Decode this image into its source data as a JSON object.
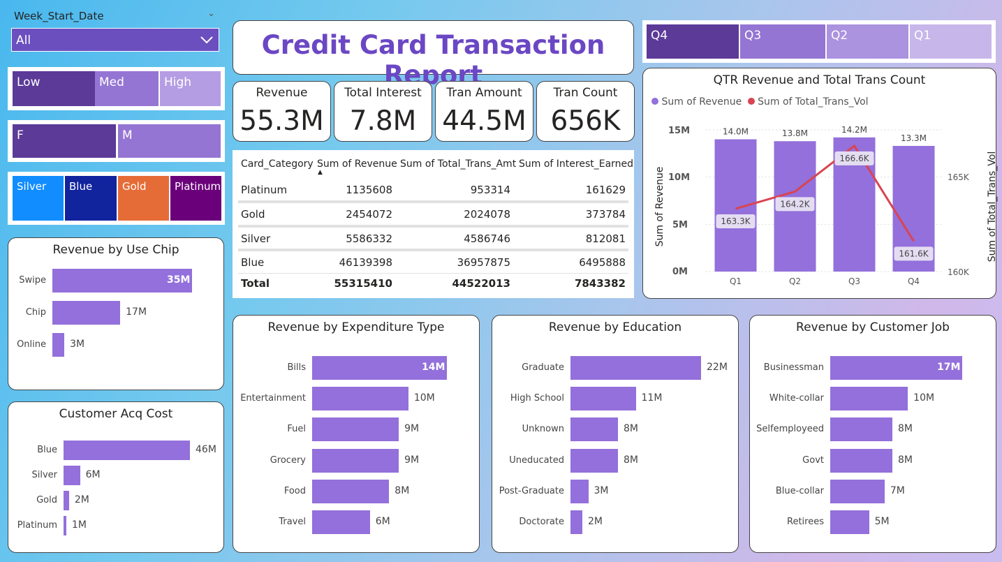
{
  "week_slicer": {
    "label": "Week_Start_Date",
    "selected": "All"
  },
  "income_slicer": {
    "items": [
      "Low",
      "Med",
      "High"
    ]
  },
  "gender_slicer": {
    "items": [
      "F",
      "M"
    ]
  },
  "card_slicer": {
    "items": [
      "Silver",
      "Blue",
      "Gold",
      "Platinum"
    ]
  },
  "quarter_slicer": {
    "items": [
      "Q4",
      "Q3",
      "Q2",
      "Q1"
    ]
  },
  "report_title": "Credit Card Transaction Report",
  "kpis": [
    {
      "label": "Revenue",
      "value": "55.3M"
    },
    {
      "label": "Total Interest",
      "value": "7.8M"
    },
    {
      "label": "Tran Amount",
      "value": "44.5M"
    },
    {
      "label": "Tran Count",
      "value": "656K"
    }
  ],
  "matrix": {
    "headers": [
      "Card_Category",
      "Sum of Revenue",
      "Sum of Total_Trans_Amt",
      "Sum of Interest_Earned"
    ],
    "rows": [
      [
        "Platinum",
        "1135608",
        "953314",
        "161629"
      ],
      [
        "Gold",
        "2454072",
        "2024078",
        "373784"
      ],
      [
        "Silver",
        "5586332",
        "4586746",
        "812081"
      ],
      [
        "Blue",
        "46139398",
        "36957875",
        "6495888"
      ]
    ],
    "total": [
      "Total",
      "55315410",
      "44522013",
      "7843382"
    ]
  },
  "charts": {
    "use_chip": {
      "title": "Revenue by Use Chip"
    },
    "acq_cost": {
      "title": "Customer Acq Cost"
    },
    "expenditure": {
      "title": "Revenue by Expenditure Type"
    },
    "education": {
      "title": "Revenue by Education"
    },
    "job": {
      "title": "Revenue by Customer Job"
    },
    "qtr": {
      "title": "QTR Revenue and Total Trans Count",
      "legend": [
        "Sum of Revenue",
        "Sum of Total_Trans_Vol"
      ],
      "ylabel_left": "Sum of Revenue",
      "ylabel_right": "Sum of Total_Trans_Vol",
      "left_ticks": [
        "15M",
        "10M",
        "5M",
        "0M"
      ],
      "right_ticks": [
        "165K",
        "160K"
      ]
    }
  },
  "colors": {
    "bar": "#9370db",
    "line": "#d94452",
    "silver": "#118dff",
    "blue": "#12239e",
    "gold": "#e66c37",
    "platinum": "#6b007b",
    "slicer_dark": "#5b3a98"
  },
  "chart_data": [
    {
      "type": "bar",
      "title": "Revenue by Use Chip",
      "categories": [
        "Swipe",
        "Chip",
        "Online"
      ],
      "values": [
        35,
        17,
        3
      ],
      "labels": [
        "35M",
        "17M",
        "3M"
      ],
      "xlim": [
        0,
        35
      ]
    },
    {
      "type": "bar",
      "title": "Customer Acq Cost",
      "categories": [
        "Blue",
        "Silver",
        "Gold",
        "Platinum"
      ],
      "values": [
        46,
        6,
        2,
        1
      ],
      "labels": [
        "46M",
        "6M",
        "2M",
        "1M"
      ],
      "xlim": [
        0,
        46
      ]
    },
    {
      "type": "bar",
      "title": "Revenue by Expenditure Type",
      "categories": [
        "Bills",
        "Entertainment",
        "Fuel",
        "Grocery",
        "Food",
        "Travel"
      ],
      "values": [
        14,
        10,
        9,
        9,
        8,
        6
      ],
      "labels": [
        "14M",
        "10M",
        "9M",
        "9M",
        "8M",
        "6M"
      ],
      "xlim": [
        0,
        14
      ]
    },
    {
      "type": "bar",
      "title": "Revenue by Education",
      "categories": [
        "Graduate",
        "High School",
        "Unknown",
        "Uneducated",
        "Post-Graduate",
        "Doctorate"
      ],
      "values": [
        22,
        11,
        8,
        8,
        3,
        2
      ],
      "labels": [
        "22M",
        "11M",
        "8M",
        "8M",
        "3M",
        "2M"
      ],
      "xlim": [
        0,
        22
      ]
    },
    {
      "type": "bar",
      "title": "Revenue by Customer Job",
      "categories": [
        "Businessman",
        "White-collar",
        "Selfemployeed",
        "Govt",
        "Blue-collar",
        "Retirees"
      ],
      "values": [
        17,
        10,
        8,
        8,
        7,
        5
      ],
      "labels": [
        "17M",
        "10M",
        "8M",
        "8M",
        "7M",
        "5M"
      ],
      "xlim": [
        0,
        17
      ]
    },
    {
      "type": "bar",
      "title": "QTR Revenue and Total Trans Count",
      "categories": [
        "Q1",
        "Q2",
        "Q3",
        "Q4"
      ],
      "series": [
        {
          "name": "Sum of Revenue",
          "values": [
            14.0,
            13.8,
            14.2,
            13.3
          ],
          "labels": [
            "14.0M",
            "13.8M",
            "14.2M",
            "13.3M"
          ]
        },
        {
          "name": "Sum of Total_Trans_Vol",
          "values": [
            163.3,
            164.2,
            166.6,
            161.6
          ],
          "labels": [
            "163.3K",
            "164.2K",
            "166.6K",
            "161.6K"
          ]
        }
      ],
      "ylim": [
        0,
        15
      ],
      "y2lim": [
        160,
        167
      ]
    }
  ]
}
